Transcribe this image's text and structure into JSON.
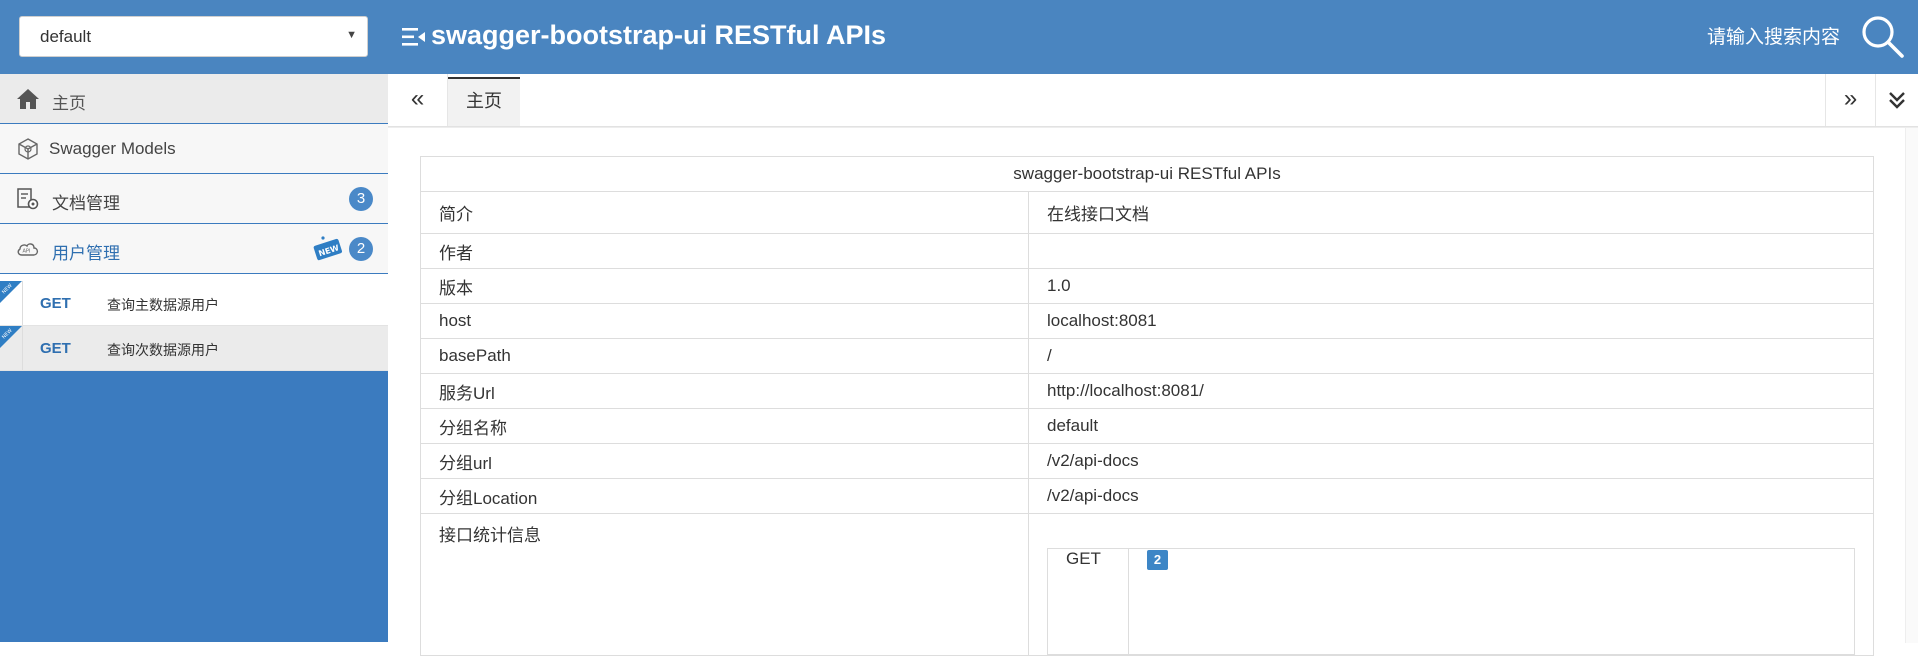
{
  "header": {
    "group_select_value": "default",
    "title": "swagger-bootstrap-ui RESTful APIs",
    "search_placeholder": "请输入搜索内容",
    "brand_color": "#4a85c0"
  },
  "sidebar": {
    "items": [
      {
        "label": "主页",
        "icon": "home-icon"
      },
      {
        "label": "Swagger Models",
        "icon": "cube-icon"
      },
      {
        "label": "文档管理",
        "icon": "settings-doc-icon",
        "badge": "3"
      },
      {
        "label": "用户管理",
        "icon": "api-cloud-icon",
        "badge": "2",
        "tag": "NEW"
      }
    ],
    "sub_items": [
      {
        "method": "GET",
        "label": "查询主数据源用户",
        "tag": "NEW"
      },
      {
        "method": "GET",
        "label": "查询次数据源用户",
        "tag": "NEW"
      }
    ]
  },
  "tabs": {
    "prev": "«",
    "next": "»",
    "items": [
      {
        "label": "主页"
      }
    ]
  },
  "info": {
    "caption": "swagger-bootstrap-ui RESTful APIs",
    "rows": [
      {
        "key": "简介",
        "value": "在线接口文档"
      },
      {
        "key": "作者",
        "value": ""
      },
      {
        "key": "版本",
        "value": "1.0"
      },
      {
        "key": "host",
        "value": "localhost:8081"
      },
      {
        "key": "basePath",
        "value": "/"
      },
      {
        "key": "服务Url",
        "value": "http://localhost:8081/"
      },
      {
        "key": "分组名称",
        "value": "default"
      },
      {
        "key": "分组url",
        "value": "/v2/api-docs"
      },
      {
        "key": "分组Location",
        "value": "/v2/api-docs"
      }
    ],
    "stats": {
      "key": "接口统计信息",
      "method": "GET",
      "count": "2"
    }
  }
}
